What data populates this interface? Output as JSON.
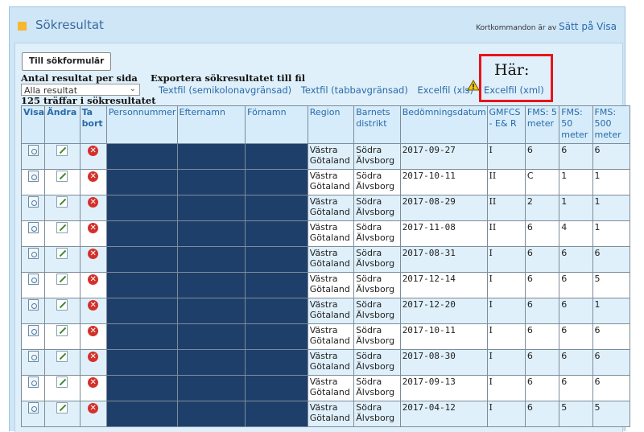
{
  "header": {
    "title": "Sökresultat",
    "shortcut_text": "Kortkommandon är av",
    "shortcut_link": "Sätt på Visa"
  },
  "controls": {
    "form_button": "Till sökformulär",
    "per_page_label": "Antal resultat per sida",
    "per_page_value": "Alla resultat",
    "export_label": "Exportera sökresultatet till fil",
    "export_links": [
      "Textfil (semikolonavgränsad)",
      "Textfil (tabbavgränsad)",
      "Excelfil (xls)"
    ],
    "excel_xml": "Excelfil (xml)",
    "highlight_note": "Här:",
    "hits_text": "125 träffar i sökresultatet"
  },
  "table": {
    "headers": [
      "Visa",
      "Ändra",
      "Ta bort",
      "Personnummer",
      "Efternamn",
      "Förnamn",
      "Region",
      "Barnets distrikt",
      "Bedömningsdatum",
      "GMFCS - E& R",
      "FMS: 5 meter",
      "FMS: 50 meter",
      "FMS: 500 meter"
    ],
    "rows": [
      {
        "region": "Västra Götaland",
        "district": "Södra Älvsborg",
        "date": "2017-09-27",
        "gmfcs": "I",
        "fms5": "6",
        "fms50": "6",
        "fms500": "6"
      },
      {
        "region": "Västra Götaland",
        "district": "Södra Älvsborg",
        "date": "2017-10-11",
        "gmfcs": "II",
        "fms5": "C",
        "fms50": "1",
        "fms500": "1"
      },
      {
        "region": "Västra Götaland",
        "district": "Södra Älvsborg",
        "date": "2017-08-29",
        "gmfcs": "II",
        "fms5": "2",
        "fms50": "1",
        "fms500": "1"
      },
      {
        "region": "Västra Götaland",
        "district": "Södra Älvsborg",
        "date": "2017-11-08",
        "gmfcs": "II",
        "fms5": "6",
        "fms50": "4",
        "fms500": "1"
      },
      {
        "region": "Västra Götaland",
        "district": "Södra Älvsborg",
        "date": "2017-08-31",
        "gmfcs": "I",
        "fms5": "6",
        "fms50": "6",
        "fms500": "6"
      },
      {
        "region": "Västra Götaland",
        "district": "Södra Älvsborg",
        "date": "2017-12-14",
        "gmfcs": "I",
        "fms5": "6",
        "fms50": "6",
        "fms500": "5"
      },
      {
        "region": "Västra Götaland",
        "district": "Södra Älvsborg",
        "date": "2017-12-20",
        "gmfcs": "I",
        "fms5": "6",
        "fms50": "6",
        "fms500": "1"
      },
      {
        "region": "Västra Götaland",
        "district": "Södra Älvsborg",
        "date": "2017-10-11",
        "gmfcs": "I",
        "fms5": "6",
        "fms50": "6",
        "fms500": "6"
      },
      {
        "region": "Västra Götaland",
        "district": "Södra Älvsborg",
        "date": "2017-08-30",
        "gmfcs": "I",
        "fms5": "6",
        "fms50": "6",
        "fms500": "6"
      },
      {
        "region": "Västra Götaland",
        "district": "Södra Älvsborg",
        "date": "2017-09-13",
        "gmfcs": "I",
        "fms5": "6",
        "fms50": "6",
        "fms500": "6"
      },
      {
        "region": "Västra Götaland",
        "district": "Södra Älvsborg",
        "date": "2017-04-12",
        "gmfcs": "I",
        "fms5": "6",
        "fms50": "5",
        "fms500": "5"
      }
    ]
  },
  "icons": {
    "view": "view-icon",
    "edit": "edit-icon",
    "delete": "delete-icon",
    "warning": "warning-icon"
  },
  "colors": {
    "highlight": "#e8141c",
    "link": "#2a6aa8",
    "masked": "#1f3f6b"
  }
}
